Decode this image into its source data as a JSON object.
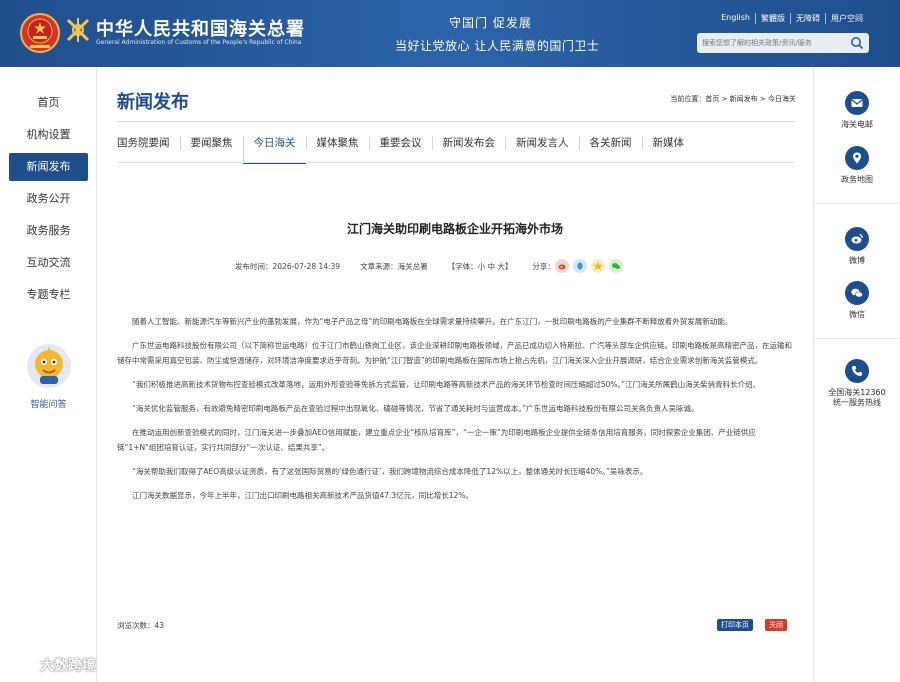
{
  "header": {
    "site_title": "中华人民共和国海关总署",
    "site_subtitle": "General Administration of Customs of the People's Republic of China",
    "slogan_line1": "守国门 促发展",
    "slogan_line2": "当好让党放心 让人民满意的国门卫士",
    "top_links": [
      "English",
      "繁體版",
      "无障碍",
      "用户空间"
    ],
    "search_placeholder": "搜索您想了解的相关政策/资讯/服务"
  },
  "left_nav": {
    "items": [
      {
        "label": "首页"
      },
      {
        "label": "机构设置"
      },
      {
        "label": "新闻发布",
        "active": true
      },
      {
        "label": "政务公开"
      },
      {
        "label": "政务服务"
      },
      {
        "label": "互动交流"
      },
      {
        "label": "专题专栏"
      }
    ],
    "assistant_label": "智能问答"
  },
  "right_nav": {
    "items": [
      {
        "label": "海关电邮",
        "icon": "mail-icon"
      },
      {
        "label": "政务地图",
        "icon": "map-icon"
      },
      {
        "label": "微博",
        "icon": "weibo-icon"
      },
      {
        "label": "微信",
        "icon": "wechat-icon"
      },
      {
        "label": "全国海关12360\n统一服务热线",
        "icon": "phone-icon"
      }
    ]
  },
  "main": {
    "page_title": "新闻发布",
    "breadcrumb": "当前位置：首页 > 新闻发布 > 今日海关",
    "tabs": [
      {
        "label": "国务院要闻"
      },
      {
        "label": "要闻聚焦"
      },
      {
        "label": "今日海关",
        "active": true
      },
      {
        "label": "媒体聚焦"
      },
      {
        "label": "重要会议"
      },
      {
        "label": "新闻发布会"
      },
      {
        "label": "新闻发言人"
      },
      {
        "label": "各关新闻"
      },
      {
        "label": "新媒体"
      }
    ],
    "article": {
      "title": "江门海关助印刷电路板企业开拓海外市场",
      "publish_time": "发布时间：2026-07-28 14:39",
      "source": "文章来源：海关总署",
      "font_size": "【字体：小 中 大】",
      "share_label": "分享：",
      "paragraphs": [
        "随着人工智能、新能源汽车等新兴产业的蓬勃发展，作为“电子产品之母”的印刷电路板在全球需求量持续攀升。在广东江门，一批印刷电路板的产业集群不断释放着外贸发展新动能。",
        "广东世运电路科技股份有限公司（以下简称世运电路）位于江门市鹤山铁岗工业区，该企业深耕印刷电路板领域，产品已成功切入特斯拉、广汽等头部车企供应链。印刷电路板是高精密产品，在运输和储存中常需采用真空包装、防尘或恒温储存，对环境洁净度要求近乎苛刻。为护航“江门智造”的印刷电路板在国际市场上抢占先机，江门海关深入企业开展调研，结合企业需求创新海关监管模式。",
        "“我们积极推进高新技术货物布控查验模式改革落地，运用外形查验等免拆方式监管，让印刷电路等高新技术产品的海关环节检查时间压缩超过50%。”江门海关所属鹤山海关柴俏青科长介绍。",
        "“海关优化监管服务，有效避免精密印刷电路板产品在查验过程中出现氧化、磕碰等情况，节省了通关耗时与运营成本。”广东世运电路科技股份有限公司关务负责人吴咏诚。",
        "在推动运用创新查验模式的同时，江门海关进一步叠加AEO信用赋能，建立重点企业“核队培育库”，“一企一策”为印刷电路板企业提供全链条信用培育服务，同时探索企业集团、产业链供应链“1+N”组团培育认证，实行共同部分“一次认证、结果共享”。",
        "“海关帮助我们取得了AEO高级认证资质，有了这张国际贸易的‘绿色通行证’，我们跨境物流综合成本降低了12%以上，整体通关时长压缩40%。”吴咏表示。",
        "江门海关数据显示，今年上半年，江门出口印刷电路相关高新技术产品货值47.3亿元，同比增长12%。"
      ],
      "views": "浏览次数：43",
      "print_label": "打印本页",
      "close_label": "关闭"
    }
  },
  "watermark": "大数跨境",
  "colors": {
    "brand_blue": "#1f4e8c",
    "close_red": "#d33b2f"
  }
}
